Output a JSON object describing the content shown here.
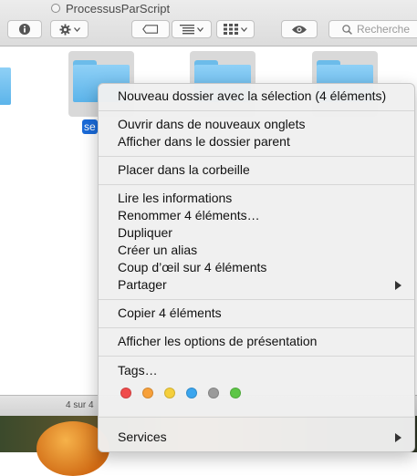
{
  "window": {
    "title": "ProcessusParScript"
  },
  "toolbar": {
    "info_icon": "info-icon",
    "action_icon": "gear-icon",
    "tag_icon": "tag-icon",
    "arrange_icon": "list-icon",
    "view_icon": "grid-icon",
    "quicklook_icon": "eye-icon",
    "search_placeholder": "Recherche"
  },
  "files": {
    "selected_name_fragment": "se"
  },
  "statusbar": {
    "text": "4 sur 4"
  },
  "context_menu": {
    "new_folder": "Nouveau dossier avec la sélection (4 éléments)",
    "open_tabs": "Ouvrir dans de nouveaux onglets",
    "show_parent": "Afficher dans le dossier parent",
    "move_to_trash": "Placer dans la corbeille",
    "get_info": "Lire les informations",
    "rename": "Renommer 4 éléments…",
    "duplicate": "Dupliquer",
    "make_alias": "Créer un alias",
    "quick_look": "Coup d’œil sur 4 éléments",
    "share": "Partager",
    "copy": "Copier 4 éléments",
    "view_options": "Afficher les options de présentation",
    "tags": "Tags…",
    "services": "Services",
    "tag_colors": [
      "#f04b4b",
      "#f7a03a",
      "#f5cf3c",
      "#3aa5ee",
      "#9b9b9b",
      "#5dc646"
    ]
  }
}
